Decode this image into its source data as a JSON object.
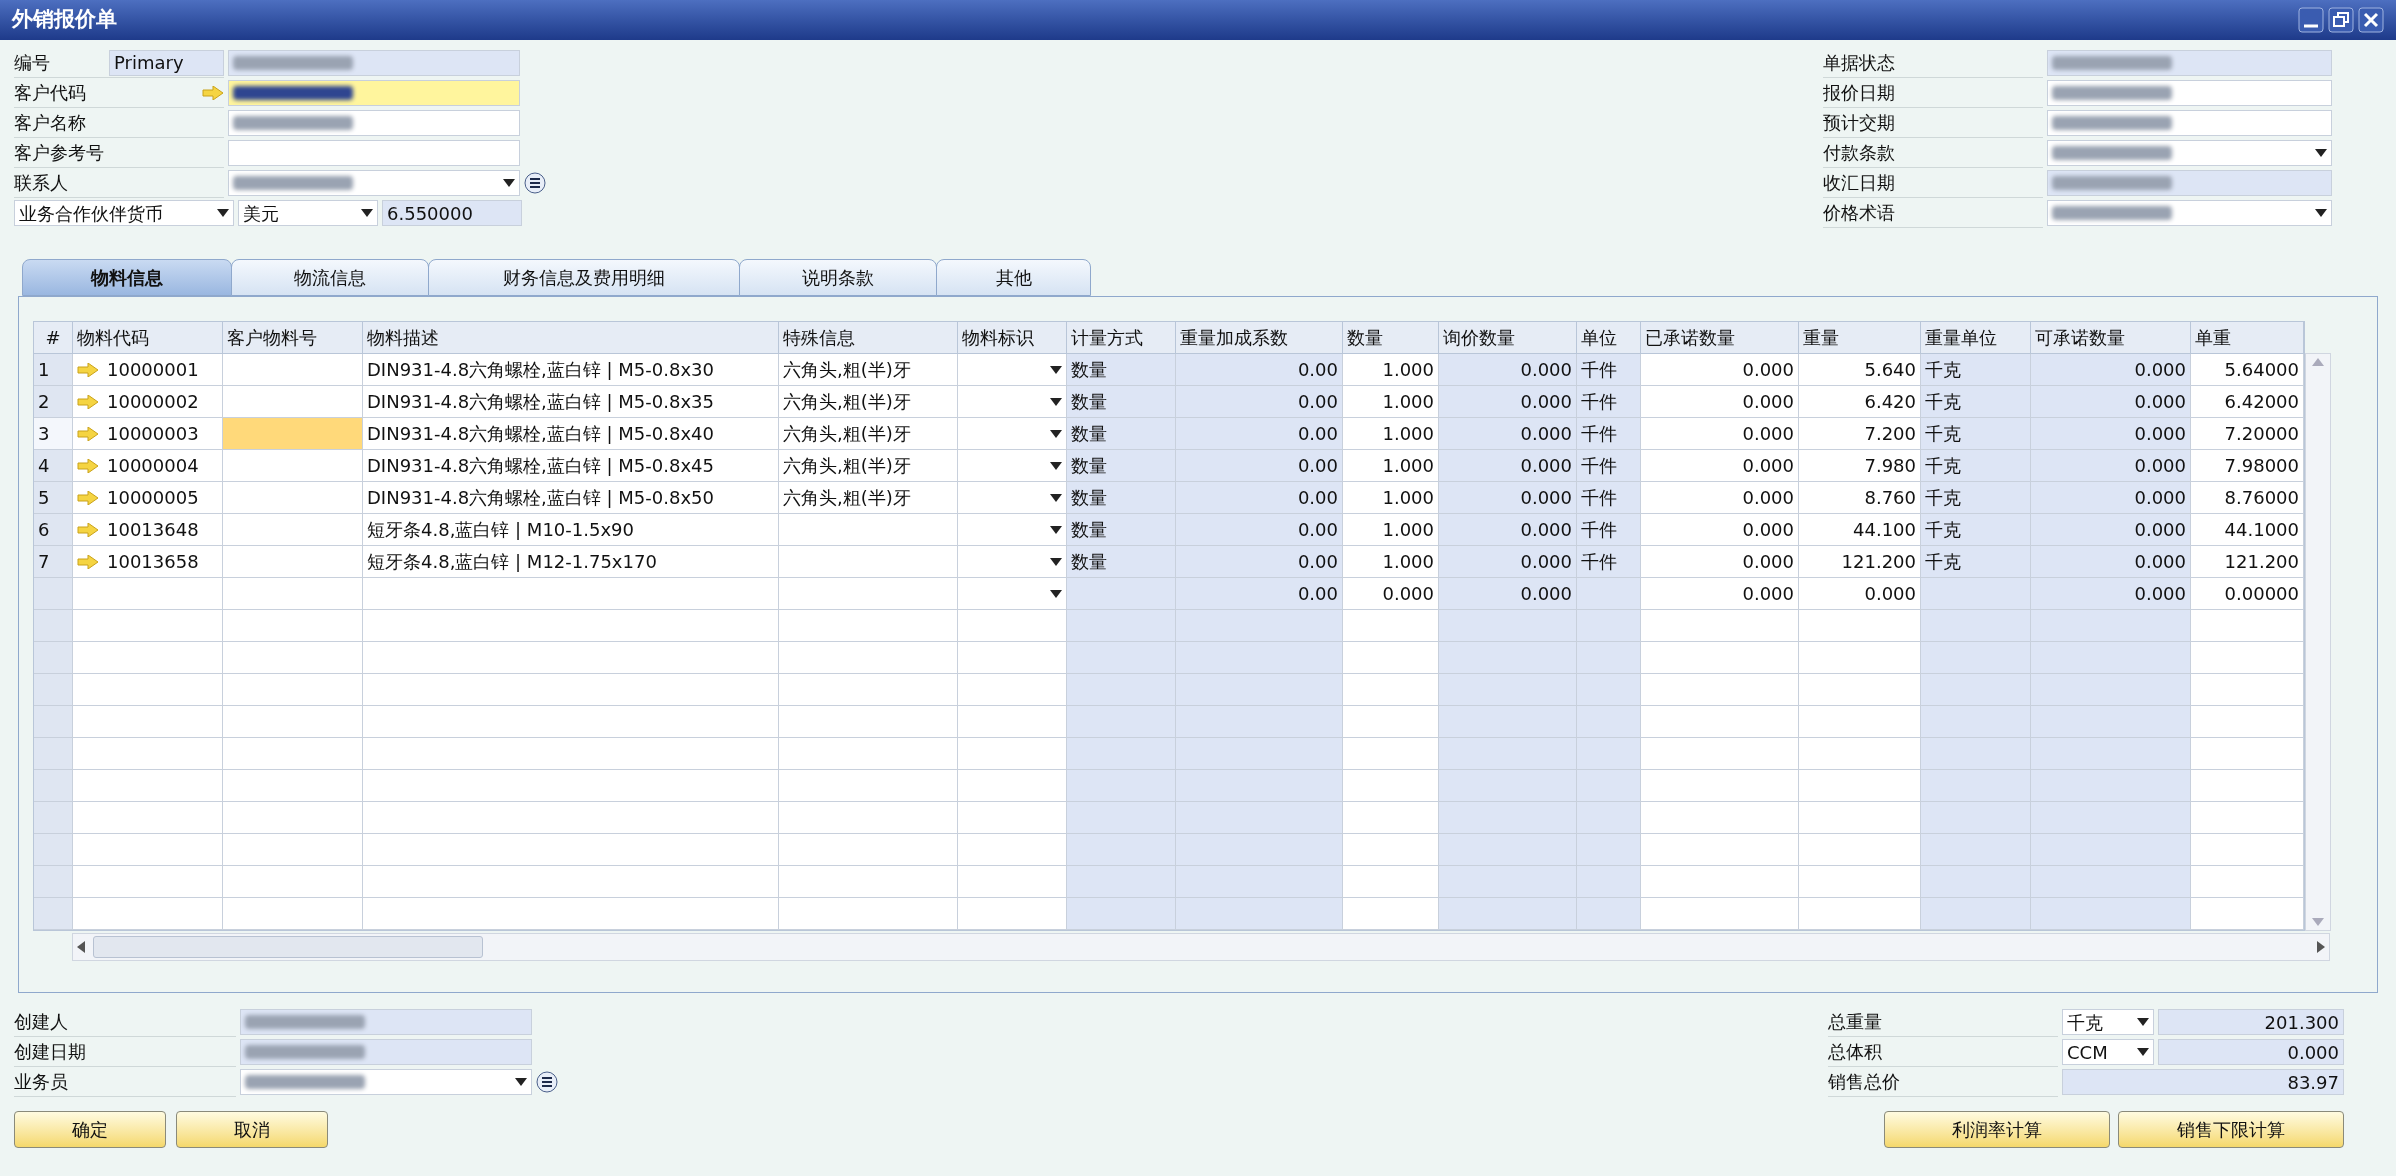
{
  "window": {
    "title": "外销报价单"
  },
  "header_left": [
    {
      "label": "编号",
      "prefix": "Primary",
      "field": {
        "kind": "readonly",
        "redacted": true
      }
    },
    {
      "label": "客户代码",
      "link": true,
      "field": {
        "kind": "focused",
        "redacted": true
      }
    },
    {
      "label": "客户名称",
      "field": {
        "kind": "input",
        "redacted": true
      }
    },
    {
      "label": "客户参考号",
      "field": {
        "kind": "input",
        "redacted": false
      }
    },
    {
      "label": "联系人",
      "list_button": true,
      "field": {
        "kind": "dropdown",
        "redacted": true
      }
    }
  ],
  "currency": {
    "type": "业务合作伙伴货币",
    "currency": "美元",
    "rate": "6.550000"
  },
  "header_right": [
    {
      "label": "单据状态",
      "field": {
        "kind": "readonly",
        "redacted": true
      }
    },
    {
      "label": "报价日期",
      "field": {
        "kind": "input",
        "redacted": true
      }
    },
    {
      "label": "预计交期",
      "field": {
        "kind": "input",
        "redacted": true
      }
    },
    {
      "label": "付款条款",
      "field": {
        "kind": "dropdown",
        "redacted": true
      }
    },
    {
      "label": "收汇日期",
      "field": {
        "kind": "readonly",
        "redacted": true
      }
    },
    {
      "label": "价格术语",
      "field": {
        "kind": "dropdown",
        "redacted": true
      }
    }
  ],
  "tabs": [
    {
      "label": "物料信息",
      "selected": true
    },
    {
      "label": "物流信息",
      "selected": false
    },
    {
      "label": "财务信息及费用明细",
      "selected": false
    },
    {
      "label": "说明条款",
      "selected": false
    },
    {
      "label": "其他",
      "selected": false
    }
  ],
  "table": {
    "index_label": "#",
    "columns": [
      {
        "label": "物料代码",
        "kind": "text",
        "readonly": false
      },
      {
        "label": "客户物料号",
        "kind": "text",
        "readonly": false
      },
      {
        "label": "物料描述",
        "kind": "text",
        "readonly": false
      },
      {
        "label": "特殊信息",
        "kind": "text",
        "readonly": false
      },
      {
        "label": "物料标识",
        "kind": "dropdown",
        "readonly": false
      },
      {
        "label": "计量方式",
        "kind": "text",
        "readonly": true
      },
      {
        "label": "重量加成系数",
        "kind": "number",
        "readonly": true
      },
      {
        "label": "数量",
        "kind": "number",
        "readonly": false
      },
      {
        "label": "询价数量",
        "kind": "number",
        "readonly": true
      },
      {
        "label": "单位",
        "kind": "text",
        "readonly": true
      },
      {
        "label": "已承诺数量",
        "kind": "number",
        "readonly": false
      },
      {
        "label": "重量",
        "kind": "number",
        "readonly": false
      },
      {
        "label": "重量单位",
        "kind": "text",
        "readonly": true
      },
      {
        "label": "可承诺数量",
        "kind": "number",
        "readonly": true
      },
      {
        "label": "单重",
        "kind": "number",
        "readonly": false
      }
    ],
    "rows": [
      {
        "number": "1",
        "selected": false,
        "link": true,
        "cells": [
          "10000001",
          null,
          "DIN931-4.8六角螺栓,蓝白锌 | M5-0.8x30",
          "六角头,粗(半)牙",
          null,
          "数量",
          "0.00",
          "1.000",
          "0.000",
          "千件",
          "0.000",
          "5.640",
          "千克",
          "0.000",
          "5.64000"
        ]
      },
      {
        "number": "2",
        "selected": false,
        "link": true,
        "cells": [
          "10000002",
          null,
          "DIN931-4.8六角螺栓,蓝白锌 | M5-0.8x35",
          "六角头,粗(半)牙",
          null,
          "数量",
          "0.00",
          "1.000",
          "0.000",
          "千件",
          "0.000",
          "6.420",
          "千克",
          "0.000",
          "6.42000"
        ]
      },
      {
        "number": "3",
        "selected": true,
        "link": true,
        "cells": [
          "10000003",
          null,
          "DIN931-4.8六角螺栓,蓝白锌 | M5-0.8x40",
          "六角头,粗(半)牙",
          null,
          "数量",
          "0.00",
          "1.000",
          "0.000",
          "千件",
          "0.000",
          "7.200",
          "千克",
          "0.000",
          "7.20000"
        ]
      },
      {
        "number": "4",
        "selected": false,
        "link": true,
        "cells": [
          "10000004",
          null,
          "DIN931-4.8六角螺栓,蓝白锌 | M5-0.8x45",
          "六角头,粗(半)牙",
          null,
          "数量",
          "0.00",
          "1.000",
          "0.000",
          "千件",
          "0.000",
          "7.980",
          "千克",
          "0.000",
          "7.98000"
        ]
      },
      {
        "number": "5",
        "selected": false,
        "link": true,
        "cells": [
          "10000005",
          null,
          "DIN931-4.8六角螺栓,蓝白锌 | M5-0.8x50",
          "六角头,粗(半)牙",
          null,
          "数量",
          "0.00",
          "1.000",
          "0.000",
          "千件",
          "0.000",
          "8.760",
          "千克",
          "0.000",
          "8.76000"
        ]
      },
      {
        "number": "6",
        "selected": false,
        "link": true,
        "cells": [
          "10013648",
          null,
          "短牙条4.8,蓝白锌 | M10-1.5x90",
          null,
          null,
          "数量",
          "0.00",
          "1.000",
          "0.000",
          "千件",
          "0.000",
          "44.100",
          "千克",
          "0.000",
          "44.1000"
        ]
      },
      {
        "number": "7",
        "selected": false,
        "link": true,
        "cells": [
          "10013658",
          null,
          "短牙条4.8,蓝白锌 | M12-1.75x170",
          null,
          null,
          "数量",
          "0.00",
          "1.000",
          "0.000",
          "千件",
          "0.000",
          "121.200",
          "千克",
          "0.000",
          "121.200"
        ]
      },
      {
        "selected": false,
        "link": false,
        "cells": [
          null,
          null,
          null,
          null,
          null,
          null,
          "0.00",
          "0.000",
          "0.000",
          null,
          "0.000",
          "0.000",
          null,
          "0.000",
          "0.00000"
        ]
      }
    ]
  },
  "footer_left": [
    {
      "label": "创建人",
      "field": {
        "kind": "readonly",
        "redacted": true
      }
    },
    {
      "label": "创建日期",
      "field": {
        "kind": "readonly",
        "redacted": true
      }
    },
    {
      "label": "业务员",
      "list_button": true,
      "field": {
        "kind": "dropdown",
        "redacted": true
      }
    }
  ],
  "totals": [
    {
      "label": "总重量",
      "unit": "千克",
      "value": "201.300"
    },
    {
      "label": "总体积",
      "unit": "CCM",
      "value": "0.000"
    },
    {
      "label": "销售总价",
      "value": "83.97"
    }
  ],
  "buttons_left": [
    "确定",
    "取消"
  ],
  "buttons_right": [
    "利润率计算",
    "销售下限计算"
  ]
}
